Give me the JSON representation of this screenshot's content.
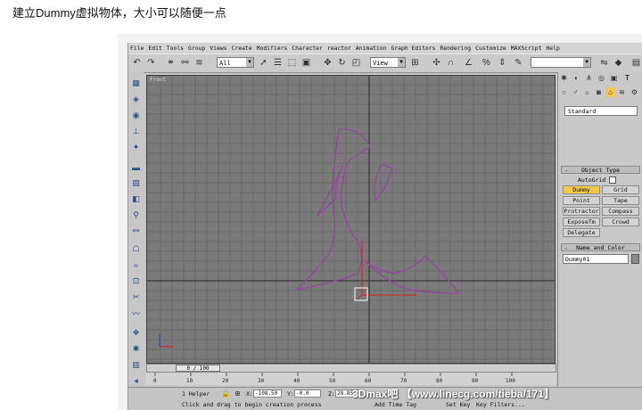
{
  "caption": "建立Dummy虚拟物体，大小可以随便一点",
  "menubar": {
    "items": [
      "File",
      "Edit",
      "Tools",
      "Group",
      "Views",
      "Create",
      "Modifiers",
      "Character",
      "reactor",
      "Animation",
      "Graph Editors",
      "Rendering",
      "Customize",
      "MAXScript",
      "Help"
    ]
  },
  "toolbar": {
    "selection_filter": "All",
    "reference_coord": "View",
    "named_selection": ""
  },
  "viewport": {
    "label": "Front"
  },
  "time": {
    "slider": "0 / 100",
    "ticks": [
      "0",
      "10",
      "20",
      "30",
      "40",
      "50",
      "60",
      "70",
      "80",
      "90",
      "100"
    ]
  },
  "status": {
    "selection": "1 Helper",
    "x_label": "X:",
    "x_value": "-108.50",
    "y_label": "Y:",
    "y_value": "-0.0",
    "z_label": "Z:",
    "z_value": "28.85",
    "prompt": "Click and drag to begin creation process",
    "add_time_tag": "Add Time Tag",
    "set_key": "Set Key",
    "key_filters": "Key Filters..."
  },
  "command_panel": {
    "category": "Standard",
    "object_type_title": "Object Type",
    "autogrid": "AutoGrid",
    "buttons": [
      "Dummy",
      "Grid",
      "Point",
      "Tape",
      "Protractor",
      "Compass",
      "ExposeTm",
      "Crowd",
      "Delegate"
    ],
    "active_button": "Dummy",
    "name_color_title": "Name and Color",
    "object_name": "Dummy01"
  },
  "watermark": "3Dmax吧 【www.linecg.com/tieba/171】",
  "colors": {
    "viewport_bg": "#7a7a7a",
    "shape_stroke": "#9b3fa8",
    "active_button": "#f2c94c",
    "dummy_box": "#ffffff",
    "gizmo_red": "#d22020"
  }
}
